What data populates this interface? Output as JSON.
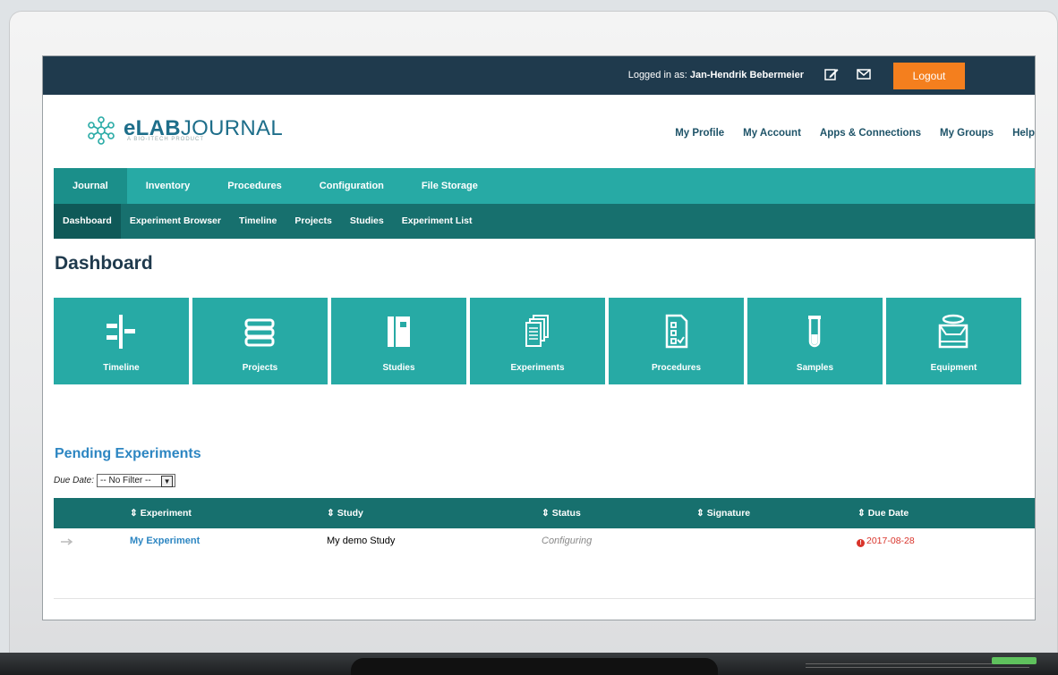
{
  "topbar": {
    "logged_in_label": "Logged in as:",
    "user_name": "Jan-Hendrik Bebermeier",
    "logout_label": "Logout"
  },
  "header": {
    "logo_main": "eLAB",
    "logo_rest": "JOURNAL",
    "logo_sub": "A BIO-ITECH PRODUCT",
    "user_nav": [
      "My Profile",
      "My Account",
      "Apps & Connections",
      "My Groups",
      "Help"
    ]
  },
  "main_nav": {
    "tabs": [
      "Journal",
      "Inventory",
      "Procedures",
      "Configuration",
      "File Storage"
    ],
    "active": "Journal"
  },
  "sub_nav": {
    "tabs": [
      "Dashboard",
      "Experiment Browser",
      "Timeline",
      "Projects",
      "Studies",
      "Experiment List"
    ],
    "active": "Dashboard"
  },
  "page": {
    "title": "Dashboard"
  },
  "tiles": [
    {
      "label": "Timeline",
      "icon": "timeline-icon"
    },
    {
      "label": "Projects",
      "icon": "projects-icon"
    },
    {
      "label": "Studies",
      "icon": "studies-icon"
    },
    {
      "label": "Experiments",
      "icon": "experiments-icon"
    },
    {
      "label": "Procedures",
      "icon": "procedures-icon"
    },
    {
      "label": "Samples",
      "icon": "samples-icon"
    },
    {
      "label": "Equipment",
      "icon": "equipment-icon"
    }
  ],
  "pending": {
    "title": "Pending Experiments",
    "filter_label": "Due Date:",
    "filter_value": "-- No Filter --",
    "columns": [
      "Experiment",
      "Study",
      "Status",
      "Signature",
      "Due Date"
    ],
    "rows": [
      {
        "experiment": "My Experiment",
        "study": "My demo Study",
        "status": "Configuring",
        "signature": "",
        "due_date": "2017-08-28"
      }
    ]
  },
  "colors": {
    "topbar": "#1f3a4d",
    "accent": "#27aaa5",
    "dark_teal": "#17706e",
    "logout": "#f47f1e",
    "link": "#2d86c2",
    "overdue": "#d9342b"
  }
}
